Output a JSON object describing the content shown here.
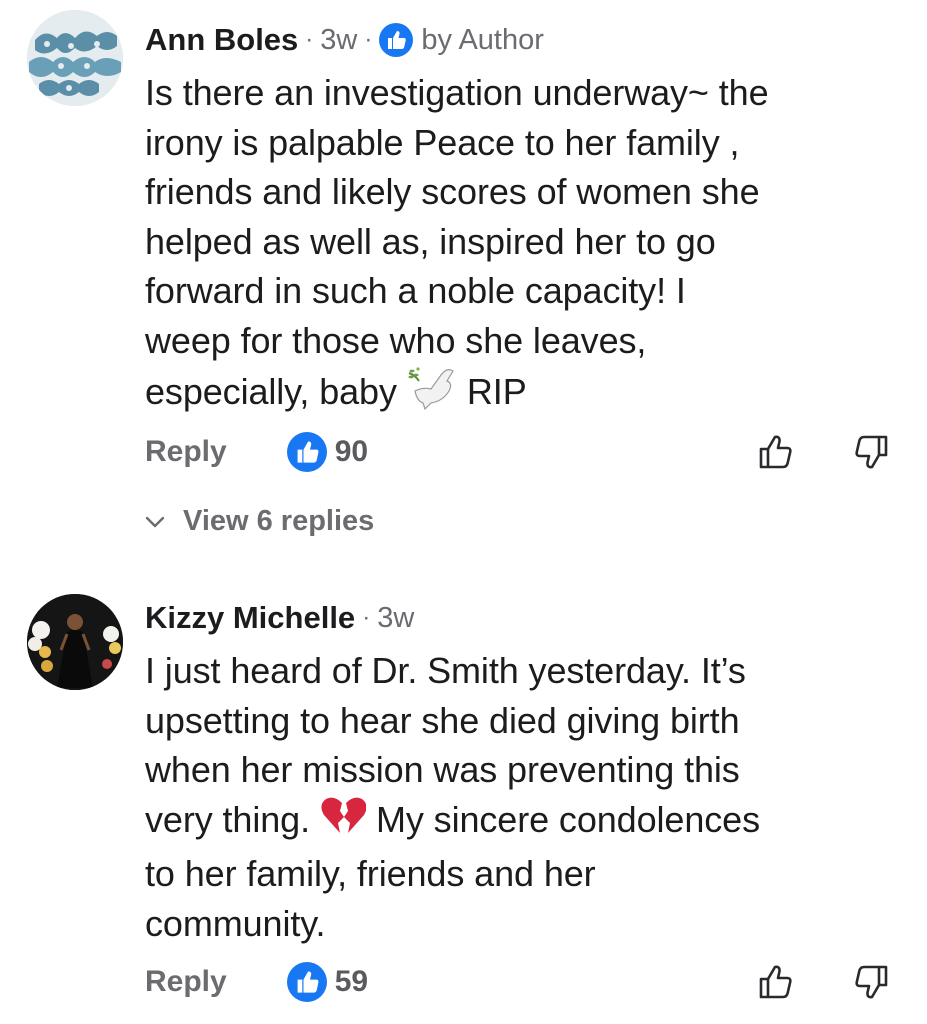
{
  "comments": [
    {
      "author": "Ann Boles",
      "time": "3w",
      "author_badge": "by Author",
      "avatar_icon": "puzzle-tile-avatar",
      "text_lines": [
        "Is there an investigation underway~ the",
        "irony is palpable Peace to her family ,",
        "friends and likely scores of women she",
        "helped as well as, inspired her to go",
        "forward in such a noble capacity! I",
        "weep for those who she leaves,"
      ],
      "last_line_before": "especially, baby",
      "last_line_emoji": "dove-with-olive-branch",
      "last_line_after": "RIP",
      "reply_label": "Reply",
      "like_count": "90",
      "view_replies_label": "View 6 replies"
    },
    {
      "author": "Kizzy Michelle",
      "time": "3w",
      "avatar_icon": "person-photo-avatar",
      "text_lines": [
        "I just heard of Dr. Smith yesterday. It’s",
        "upsetting to hear she died giving birth",
        "when her mission was preventing this"
      ],
      "line4_before": "very thing.",
      "line4_emoji": "broken-heart",
      "line4_after": "My sincere condolences",
      "text_lines_end": [
        "to her family, friends and her",
        "community."
      ],
      "reply_label": "Reply",
      "like_count": "59"
    }
  ],
  "colors": {
    "like_blue": "#1877F2",
    "secondary_text": "#6b6b70",
    "primary_text": "#1c1c1e"
  }
}
